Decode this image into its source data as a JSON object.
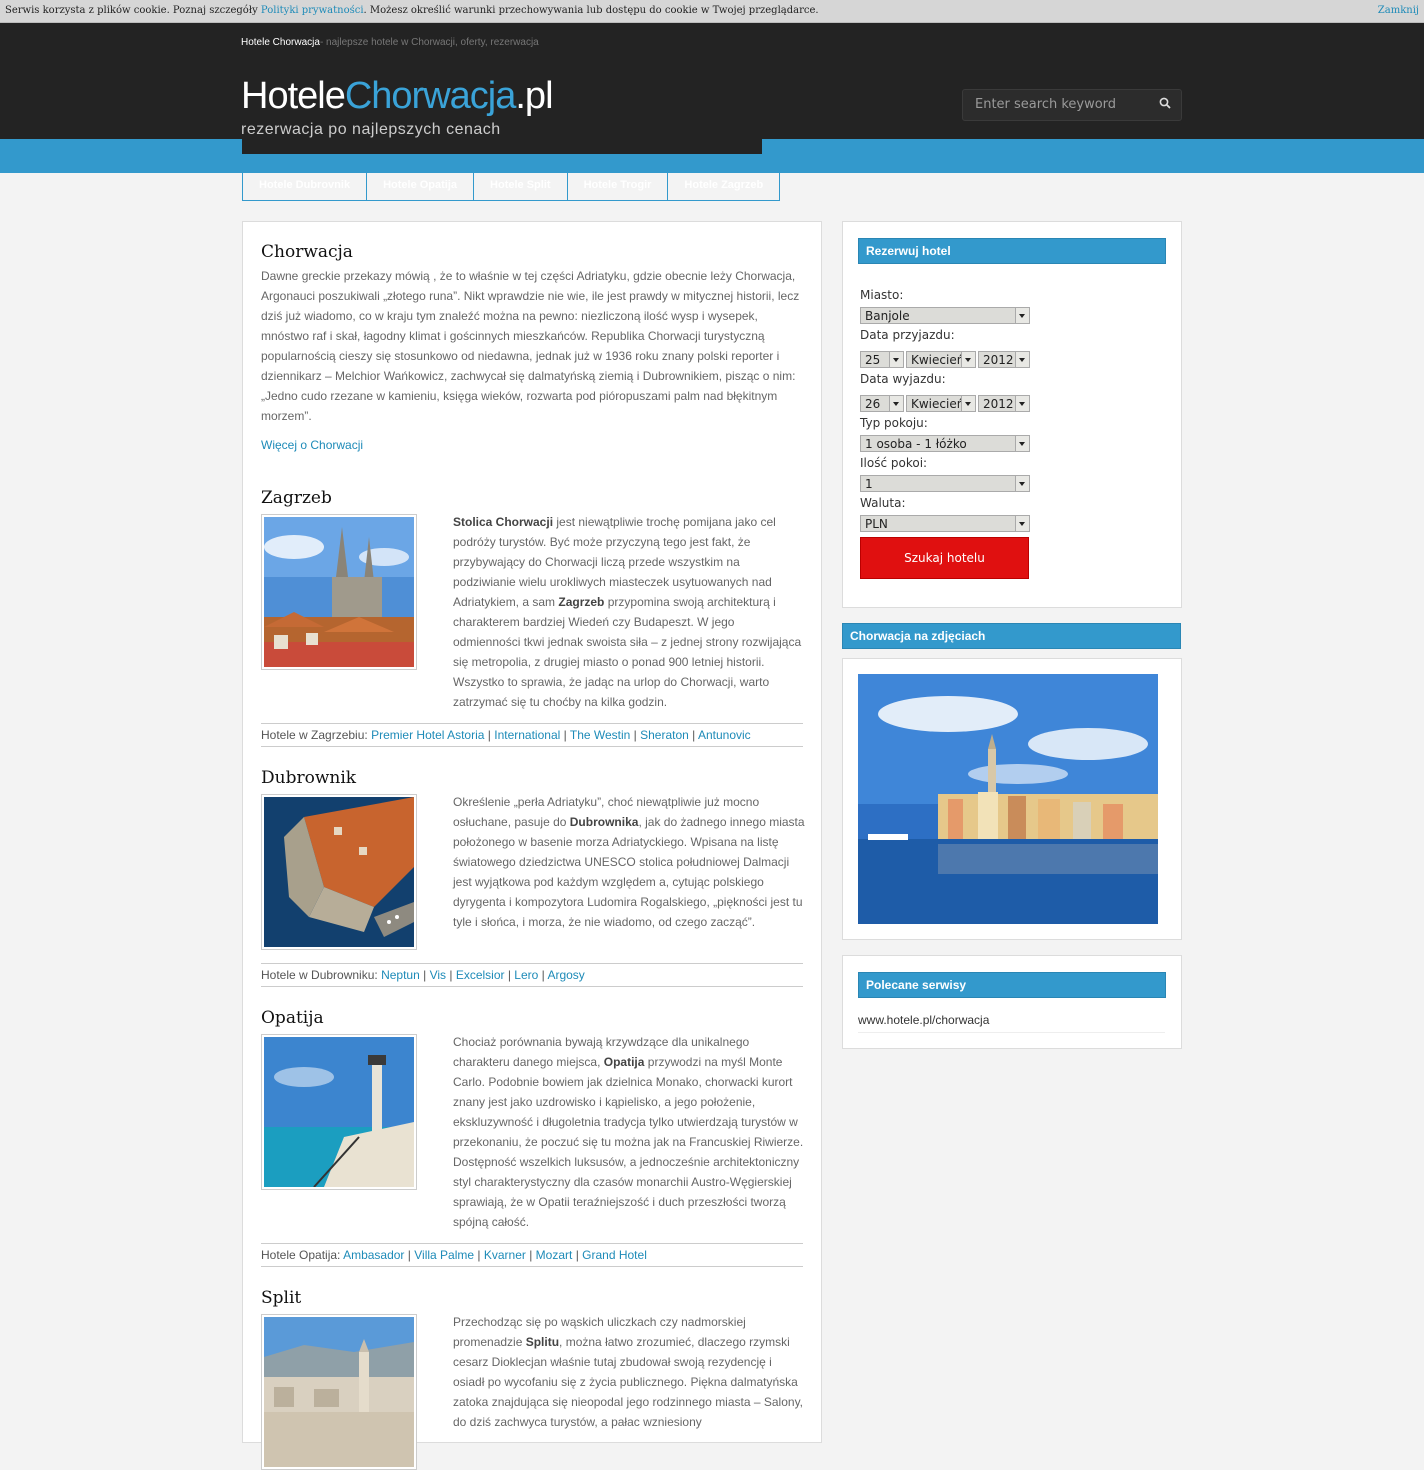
{
  "cookie": {
    "text_before": "Serwis korzysta z plików cookie. Poznaj szczegóły ",
    "link": "Polityki prywatności",
    "text_after": ". Możesz określić warunki przechowywania lub dostępu do cookie w Twojej przeglądarce.",
    "close": "Zamknij"
  },
  "header": {
    "site_name": "Hotele Chorwacja",
    "tagline": "- najlepsze hotele w Chorwacji, oferty, rezerwacja",
    "logo_part1": "Hotele",
    "logo_part2": "Chorwacja",
    "logo_part3": ".pl",
    "logo_sub": "rezerwacja po najlepszych cenach",
    "search_placeholder": "Enter search keyword"
  },
  "nav": [
    "Hotele Dubrovnik",
    "Hotele Opatija",
    "Hotele Split",
    "Hotele Trogir",
    "Hotele Zagrzeb"
  ],
  "intro": {
    "title": "Chorwacja",
    "text": "Dawne greckie przekazy mówią , że to właśnie w tej części Adriatyku, gdzie obecnie leży Chorwacja, Argonauci poszukiwali „złotego runa”. Nikt wprawdzie nie wie, ile jest prawdy w mitycznej historii, lecz dziś już wiadomo, co w kraju tym znaleźć można na pewno: niezliczoną ilość wysp i wysepek, mnóstwo raf i skał, łagodny klimat i gościnnych mieszkańców. Republika Chorwacji turystyczną popularnością cieszy się stosunkowo od niedawna, jednak już w 1936 roku znany polski reporter i dziennikarz – Melchior Wańkowicz, zachwycał się dalmatyńską ziemią i Dubrownikiem, pisząc o nim: „Jedno cudo rzezane w kamieniu, księga wieków, rozwarta pod pióropuszami palm nad błękitnym morzem”.",
    "more": "Więcej o Chorwacji"
  },
  "sections": [
    {
      "title": "Zagrzeb",
      "bold1": "Stolica Chorwacji",
      "text1": " jest niewątpliwie trochę pomijana jako cel podróży turystów. Być może przyczyną tego jest fakt, że przybywający do Chorwacji liczą przede wszystkim na podziwianie wielu urokliwych miasteczek usytuowanych nad Adriatykiem, a sam ",
      "bold2": "Zagrzeb",
      "text2": " przypomina swoją architekturą i charakterem bardziej Wiedeń czy Budapeszt. W jego odmienności tkwi jednak swoista siła – z jednej strony rozwijająca się metropolia, z drugiej miasto o ponad 900 letniej historii. Wszystko to sprawia, że jadąc na urlop do Chorwacji, warto zatrzymać się tu choćby na kilka godzin.",
      "hotels_label": "Hotele w Zagrzebiu: ",
      "hotels": [
        "Premier Hotel Astoria",
        "International",
        "The Westin",
        "Sheraton",
        "Antunovic"
      ]
    },
    {
      "title": "Dubrownik",
      "text1": "Określenie „perła Adriatyku”, choć niewątpliwie już mocno osłuchane, pasuje do ",
      "bold1": "Dubrownika",
      "text2": ", jak do żadnego innego miasta położonego w basenie morza Adriatyckiego. Wpisana na listę światowego dziedzictwa UNESCO stolica południowej Dalmacji jest wyjątkowa pod każdym względem a, cytując polskiego dyrygenta i kompozytora Ludomira Rogalskiego, „piękności jest tu tyle i słońca, i morza, że nie wiadomo, od czego zacząć”.",
      "hotels_label": "Hotele w Dubrowniku: ",
      "hotels": [
        "Neptun",
        "Vis",
        "Excelsior",
        "Lero",
        "Argosy"
      ]
    },
    {
      "title": "Opatija",
      "text1": "Chociaż porównania bywają krzywdzące dla unikalnego charakteru danego miejsca, ",
      "bold1": "Opatija",
      "text2": " przywodzi na myśl Monte Carlo. Podobnie bowiem jak dzielnica Monako, chorwacki kurort znany jest jako uzdrowisko i kąpielisko, a jego położenie, ekskluzywność i długoletnia tradycja tylko utwierdzają turystów w przekonaniu, że poczuć się tu można jak na Francuskiej Riwierze. Dostępność wszelkich luksusów, a jednocześnie architektoniczny styl charakterystyczny dla czasów monarchii Austro-Węgierskiej sprawiają, że w Opatii teraźniejszość i duch przeszłości tworzą spójną całość.",
      "hotels_label": "Hotele Opatija: ",
      "hotels": [
        "Ambasador",
        "Villa Palme",
        "Kvarner",
        "Mozart",
        "Grand Hotel"
      ]
    },
    {
      "title": "Split",
      "text1": "Przechodząc się po wąskich uliczkach czy nadmorskiej promenadzie ",
      "bold1": "Splitu",
      "text2": ", można łatwo zrozumieć, dlaczego rzymski cesarz Dioklecjan właśnie tutaj zbudował swoją rezydencję i osiadł po wycofaniu się z życia publicznego. Piękna dalmatyńska zatoka znajdująca się nieopodal jego rodzinnego miasta – Salony, do dziś zachwyca turystów, a pałac wzniesiony"
    }
  ],
  "booking": {
    "title": "Rezerwuj hotel",
    "city_label": "Miasto:",
    "city_value": "Banjole",
    "arrival_label": "Data przyjazdu:",
    "arrival_day": "25",
    "arrival_month": "Kwiecień",
    "arrival_year": "2012",
    "departure_label": "Data wyjazdu:",
    "departure_day": "26",
    "departure_month": "Kwiecień",
    "departure_year": "2012",
    "room_type_label": "Typ pokoju:",
    "room_type_value": "1 osoba - 1 łóżko",
    "rooms_label": "Ilość pokoi:",
    "rooms_value": "1",
    "currency_label": "Waluta:",
    "currency_value": "PLN",
    "button": "Szukaj hotelu"
  },
  "photos": {
    "title": "Chorwacja na zdjęciach"
  },
  "recommended": {
    "title": "Polecane serwisy",
    "link": "www.hotele.pl/chorwacja"
  }
}
